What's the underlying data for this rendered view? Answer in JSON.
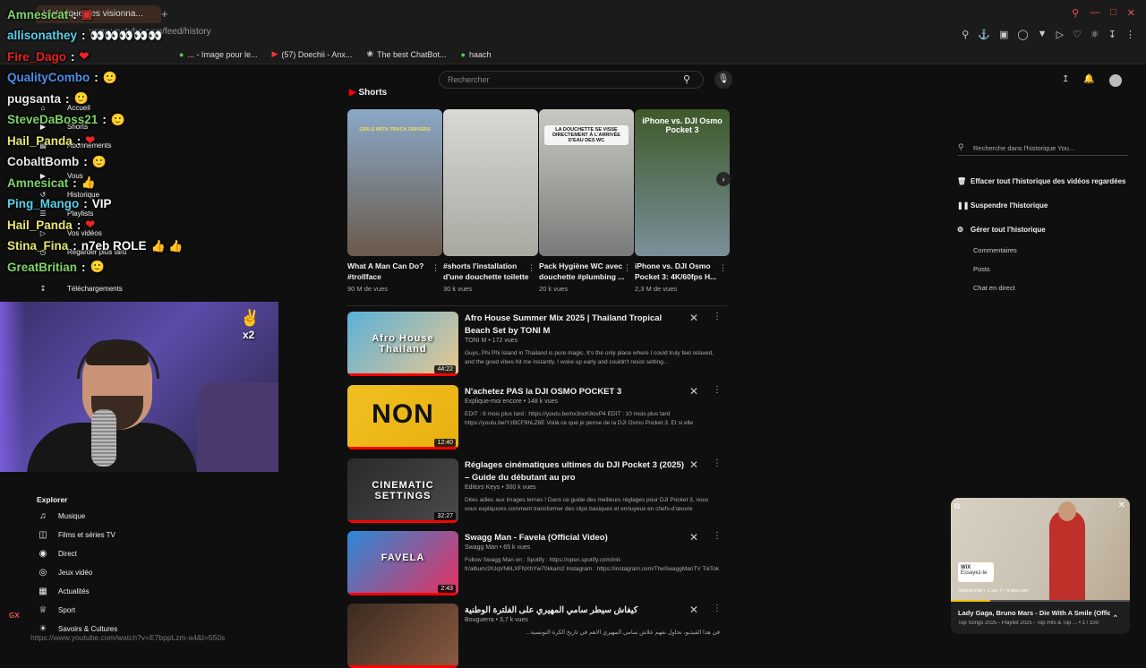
{
  "browser": {
    "tab_title": "Historique des visionna...",
    "url": "www.youtube.com/feed/history",
    "bookmarks": [
      {
        "icon": "bookmark-icon",
        "label": "... - Image pour le..."
      },
      {
        "icon": "youtube-icon",
        "label": "(57) Doechii - Anx..."
      },
      {
        "icon": "openai-icon",
        "label": "The best ChatBot..."
      },
      {
        "icon": "bookmark-icon",
        "label": "haach"
      }
    ],
    "status_url": "https://www.youtube.com/watch?v=E7bppLzm-a4&t=550s"
  },
  "youtube": {
    "search_placeholder": "Rechercher",
    "shorts_heading": "Shorts",
    "shorts": [
      {
        "title": "What A Man Can Do? #trollface",
        "views": "90 M de vues",
        "overlay": "GIRLS WITH TRUCK DRIVERS",
        "colors": [
          "#8aa8c8",
          "#6b5a4a"
        ]
      },
      {
        "title": "#shorts l'installation d'une douchette toilette",
        "views": "30 k vues",
        "overlay": "",
        "colors": [
          "#d8d8d4",
          "#a9a9a2"
        ]
      },
      {
        "title": "Pack Hygiène WC avec douchette  #plumbing ...",
        "views": "20 k vues",
        "overlay": "LA DOUCHETTE SE VISSE DIRECTEMENT À L'ARRIVÉE D'EAU DES WC",
        "colors": [
          "#c9c9c4",
          "#7a7a78"
        ]
      },
      {
        "title": "iPhone vs. DJI Osmo Pocket 3: 4K/60fps H...",
        "views": "2,3 M de vues",
        "overlay": "iPhone vs. DJI Osmo Pocket 3",
        "colors": [
          "#3e5a2a",
          "#7a8f9a"
        ]
      }
    ],
    "videos": [
      {
        "title": "Afro House Summer Mix 2025 | Thailand Tropical Beach Set by TONI M",
        "channel": "TONI M • 172 vues",
        "desc": "Guys, Phi Phi Island in Thailand is pure magic. It's the only place where I could truly feel relaxed, and the good vibes hit me instantly. I woke up early and couldn't resist setting...",
        "duration": "44:22",
        "thumb_text": "Afro House Thailand",
        "colors": [
          "#5ab0d8",
          "#e8c890"
        ]
      },
      {
        "title": "N'achetez PAS la DJI OSMO POCKET 3",
        "channel": "Explique-moi encore • 148 k vues",
        "desc": "EDIT : 6 mois plus tard : https://youtu.be/nx3ncK8ovP4 EDIT : 10 mois plus tard https://youtu.be/YzBCF8hLZ6E Voilà ce que je pense de la DJI Osmo Pocket 3. Et si elle l'intéresse,...",
        "duration": "12:40",
        "thumb_text": "NON",
        "colors": [
          "#f0c020",
          "#e8b010"
        ]
      },
      {
        "title": "Réglages cinématiques ultimes du DJI Pocket 3 (2025) – Guide du débutant au pro",
        "channel": "Editors Keys • 300 k vues",
        "desc": "Dites adieu aux images ternes ! Dans ce guide des meilleurs réglages pour DJI Pocket 3, nous vous expliquons comment transformer des clips basiques et ennuyeux en chefs-d'œuvre cinématographiqu...",
        "duration": "32:27",
        "thumb_text": "CINEMATIC SETTINGS",
        "colors": [
          "#2a2a2a",
          "#4a4a4a"
        ]
      },
      {
        "title": "Swagg Man - Favela (Official Video)",
        "channel": "Swagg Man • 65 k vues",
        "desc": "Follow Swagg Man on : Spotify : https://open.spotify.com/intl-fr/album/2IUqVN6LXFNXhYw70kkam2 Instagram : https://instagram.com/TheSwaggManTV TikTok : https://tiktok.com/@theswaggmantv Twitter...",
        "duration": "2:43",
        "thumb_text": "FAVELA",
        "colors": [
          "#2a8ad8",
          "#e83060"
        ]
      },
      {
        "title": "كيفاش سيطر سامي المهيري على الفلترة الوطنية",
        "channel": "Bouguerra • 3,7 k vues",
        "desc": "في هذا الفيديو، نحاول نفهم علاش سامي المهيري الاهم في تاريخ الكرة التونسية...",
        "duration": "",
        "thumb_text": "",
        "colors": [
          "#3a2a20",
          "#8a5a40"
        ]
      }
    ],
    "history_panel": {
      "search_placeholder": "Recherche dans l'historique You...",
      "actions": [
        "Effacer tout l'historique des vidéos regardées",
        "Suspendre l'historique",
        "Gérer tout l'historique"
      ],
      "sub_items": [
        "Commentaires",
        "Posts",
        "Chat en direct"
      ]
    },
    "sidebar_top": [
      "Accueil",
      "Shorts",
      "Abonnements",
      "Vous",
      "Historique",
      "Playlists",
      "Vos vidéos",
      "Regarder plus tard",
      "Téléchargements"
    ],
    "explore_heading": "Explorer",
    "explore_items": [
      {
        "icon": "music-icon",
        "label": "Musique"
      },
      {
        "icon": "film-icon",
        "label": "Films et séries TV"
      },
      {
        "icon": "live-icon",
        "label": "Direct"
      },
      {
        "icon": "gamepad-icon",
        "label": "Jeux vidéo"
      },
      {
        "icon": "news-icon",
        "label": "Actualités"
      },
      {
        "icon": "trophy-icon",
        "label": "Sport"
      },
      {
        "icon": "culture-icon",
        "label": "Savoirs & Cultures"
      }
    ],
    "miniplayer": {
      "title": "Lady Gaga, Bruno Mars - Die With A Smile (Offici...",
      "subtitle": "Top Songs 2025 - Playlist 2025 - Top Hits & Top ... • 1 / 100",
      "ad_label": "Sponsorisé • 1 sur 2 • fr.wix.com",
      "ad_button": "Essayez-le",
      "ad_domain": "fr.wix.com"
    }
  },
  "chat": [
    {
      "user": "Amnesicat",
      "color": "#7fd36a",
      "message": "",
      "emote": "square"
    },
    {
      "user": "allisonathey",
      "color": "#5ad0e8",
      "message": "",
      "emote": "eyes"
    },
    {
      "user": "Fire_Dago",
      "color": "#e82020",
      "message": "",
      "emote": "heart"
    },
    {
      "user": "QualityCombo",
      "color": "#4a90e8",
      "message": "",
      "emote": "face"
    },
    {
      "user": "pugsanta",
      "color": "#e8e8e8",
      "message": "",
      "emote": "face"
    },
    {
      "user": "SteveDaBoss21",
      "color": "#7fd36a",
      "message": "",
      "emote": "face"
    },
    {
      "user": "Hail_Panda",
      "color": "#e8e870",
      "message": "",
      "emote": "heart"
    },
    {
      "user": "CobaltBomb",
      "color": "#e8e8e8",
      "message": "",
      "emote": "face"
    },
    {
      "user": "Amnesicat",
      "color": "#7fd36a",
      "message": "",
      "emote": "thumb"
    },
    {
      "user": "Ping_Mango",
      "color": "#5ad0e8",
      "message": "VIP",
      "emote": ""
    },
    {
      "user": "Hail_Panda",
      "color": "#e8e870",
      "message": "",
      "emote": "heart"
    },
    {
      "user": "Stina_Fina",
      "color": "#e8e870",
      "message": "n7eb ROLE",
      "emote": "thumbs"
    },
    {
      "user": "GreatBritian",
      "color": "#7fd36a",
      "message": "",
      "emote": "face"
    }
  ],
  "webcam": {
    "badge": "x2"
  },
  "colors": {
    "accent": "#ff0000",
    "bg": "#0f0f0f"
  }
}
